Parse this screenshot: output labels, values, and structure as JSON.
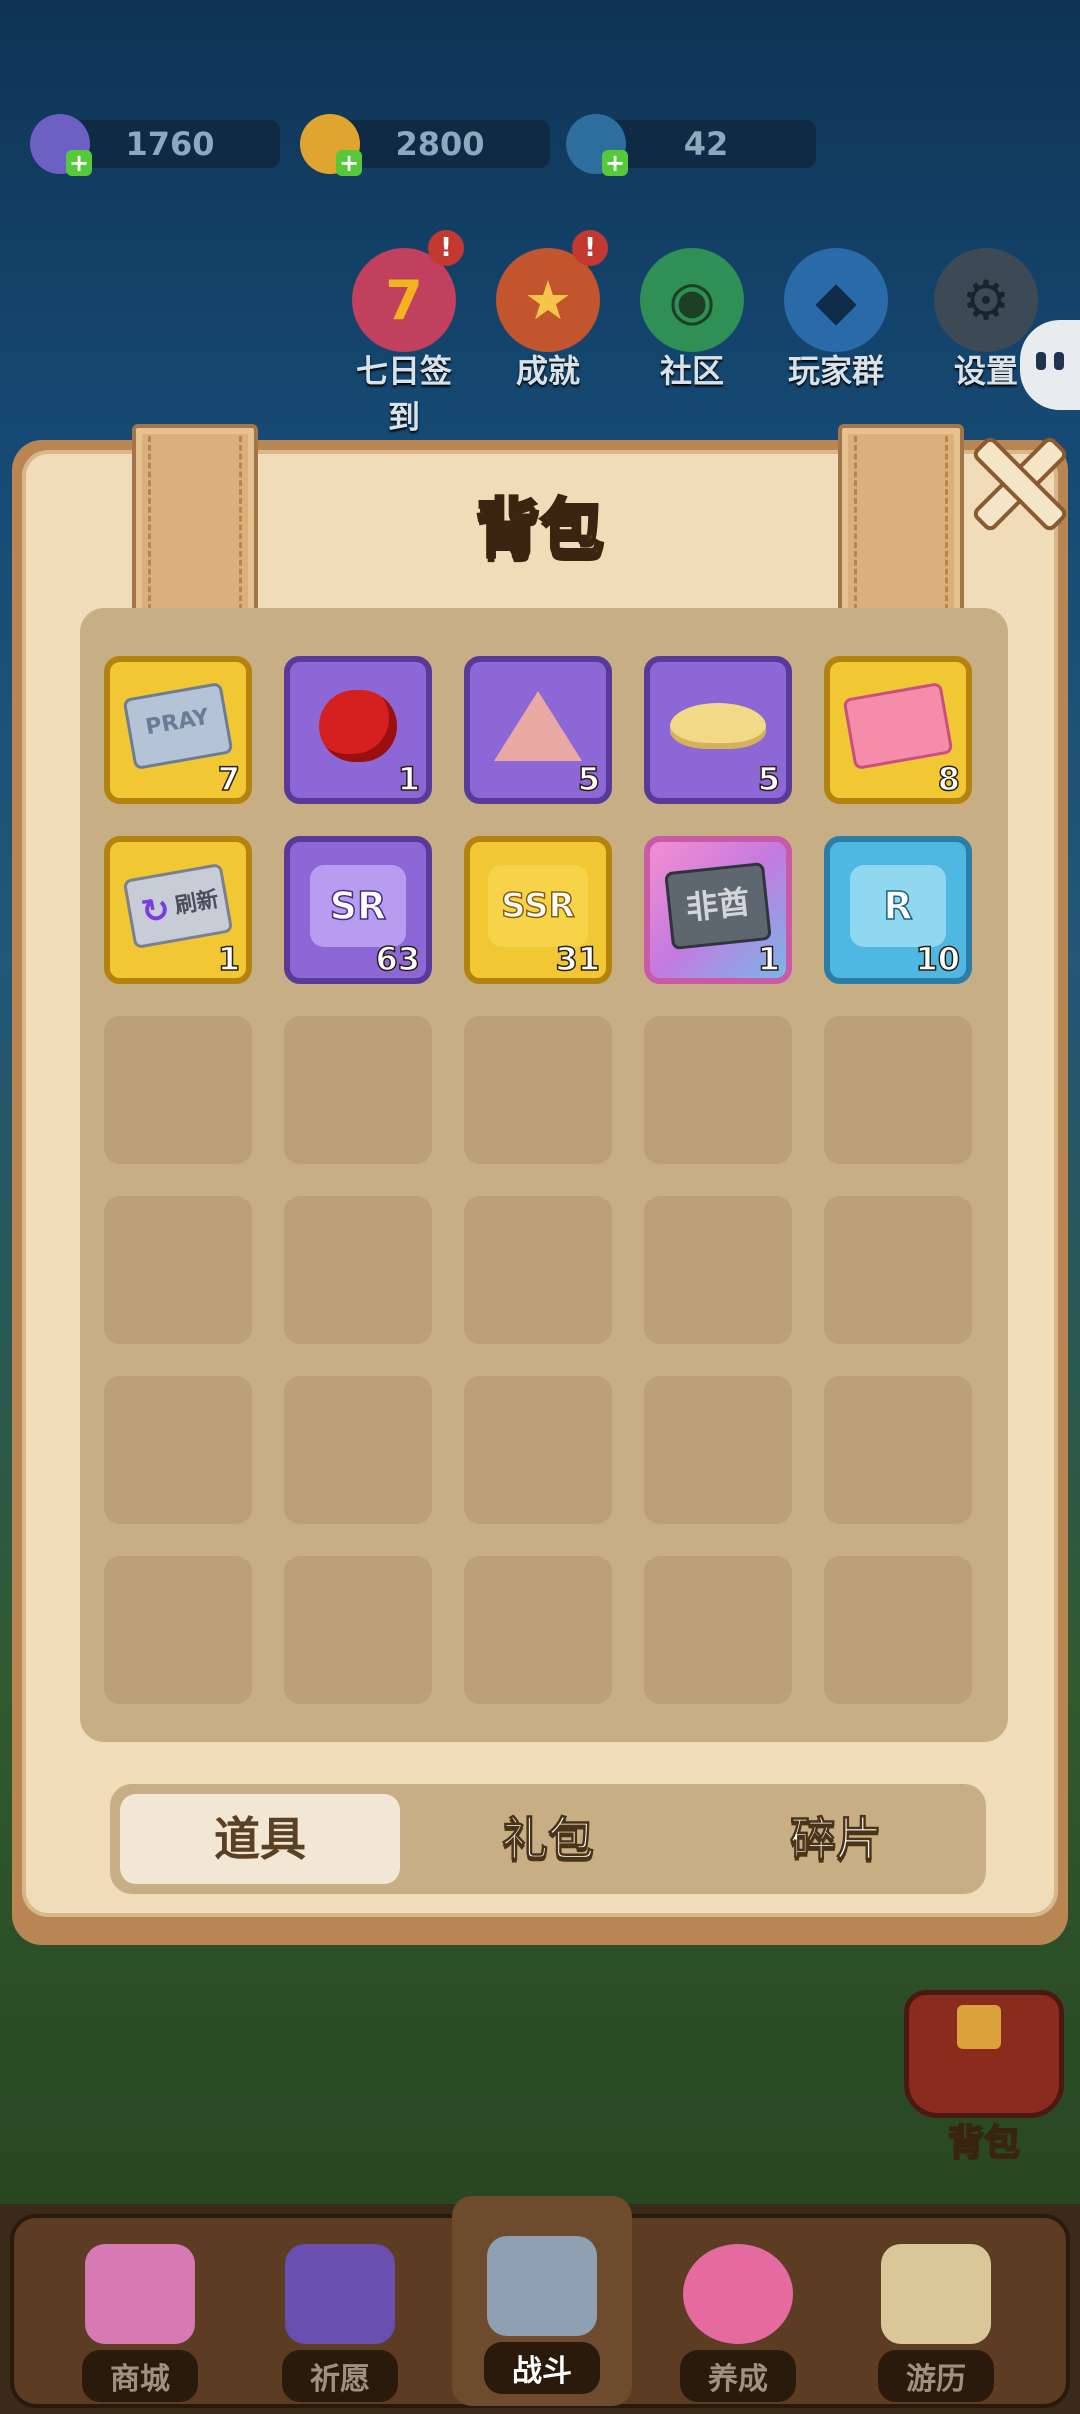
{
  "resources": [
    {
      "icon": "gem-icon",
      "value": "1760"
    },
    {
      "icon": "coin-icon",
      "value": "2800"
    },
    {
      "icon": "energy-icon",
      "value": "42"
    }
  ],
  "top_menu": [
    {
      "label": "七日签到",
      "icon": "seven-day-icon",
      "glyph": "7",
      "badge": "!"
    },
    {
      "label": "成就",
      "icon": "trophy-icon",
      "glyph": "★",
      "badge": "!"
    },
    {
      "label": "社区",
      "icon": "community-icon",
      "glyph": "◉",
      "badge": ""
    },
    {
      "label": "玩家群",
      "icon": "penguin-icon",
      "glyph": "◆",
      "badge": ""
    },
    {
      "label": "设置",
      "icon": "gear-icon",
      "glyph": "⚙",
      "badge": ""
    }
  ],
  "panel": {
    "title": "背包",
    "items": [
      {
        "name": "pray-ticket",
        "art": "PRAY",
        "rarity": "gold",
        "count": "7"
      },
      {
        "name": "apple",
        "art": "",
        "rarity": "purple",
        "count": "1"
      },
      {
        "name": "cake-slice",
        "art": "",
        "rarity": "purple",
        "count": "5"
      },
      {
        "name": "potato-chips",
        "art": "",
        "rarity": "purple",
        "count": "5"
      },
      {
        "name": "pink-ticket",
        "art": "",
        "rarity": "gold",
        "count": "8"
      },
      {
        "name": "refresh-ticket",
        "art": "刷新",
        "rarity": "gold",
        "count": "1"
      },
      {
        "name": "sr-fragment",
        "art": "SR",
        "rarity": "purple",
        "count": "63"
      },
      {
        "name": "ssr-fragment",
        "art": "SSR",
        "rarity": "gold",
        "count": "31"
      },
      {
        "name": "non-chief-plate",
        "art": "非酋",
        "rarity": "pink",
        "count": "1"
      },
      {
        "name": "r-fragment",
        "art": "R",
        "rarity": "blue",
        "count": "10"
      }
    ],
    "tabs": [
      "道具",
      "礼包",
      "碎片"
    ],
    "active_tab": 0
  },
  "bag_button": {
    "label": "背包"
  },
  "bottom_nav": [
    {
      "label": "商城",
      "icon": "shop-icon"
    },
    {
      "label": "祈愿",
      "icon": "wish-card-icon"
    },
    {
      "label": "战斗",
      "icon": "crossed-swords-icon"
    },
    {
      "label": "养成",
      "icon": "paw-icon"
    },
    {
      "label": "游历",
      "icon": "travel-map-icon"
    }
  ],
  "colors": {
    "gold": "#f2c734",
    "purple": "#8d67d6",
    "blue": "#4fb8e2",
    "panel": "#f0dcb8"
  }
}
